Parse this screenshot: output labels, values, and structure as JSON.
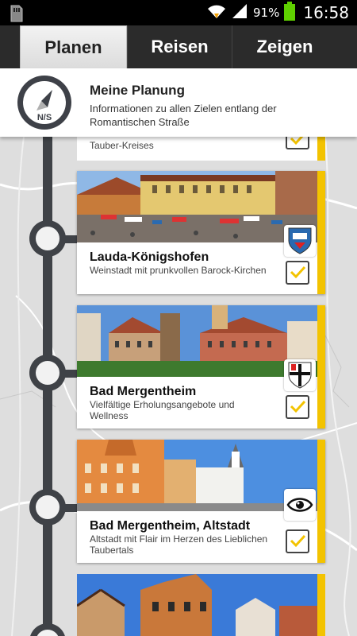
{
  "status_bar": {
    "battery_percent": "91%",
    "time": "16:58",
    "icons": [
      "sd-card-icon",
      "wifi-icon",
      "signal-icon",
      "battery-icon"
    ]
  },
  "tabs": [
    {
      "label": "Planen",
      "active": true
    },
    {
      "label": "Reisen",
      "active": false
    },
    {
      "label": "Zeigen",
      "active": false
    }
  ],
  "header": {
    "compass_label": "N/S",
    "title": "Meine Planung",
    "subtitle": "Informationen zu allen Zielen entlang der Romantischen Straße"
  },
  "cards": [
    {
      "title": "",
      "description": "Tauber-Kreises",
      "checked": true
    },
    {
      "title": "Lauda-Königshofen",
      "description": "Weinstadt mit prunkvollen Barock-Kirchen",
      "badge": "coat-of-arms-lauda",
      "checked": true
    },
    {
      "title": "Bad Mergentheim",
      "description": "Vielfältige Erholungsangebote und Wellness",
      "badge": "coat-of-arms-bad-mergentheim",
      "checked": true
    },
    {
      "title": "Bad Mergentheim, Altstadt",
      "description": "Altstadt mit Flair im Herzen des Lieblichen Taubertals",
      "badge": "eye-icon",
      "checked": true
    }
  ],
  "colors": {
    "accent_yellow": "#f3c300",
    "timeline": "#3f4247",
    "tab_bar": "#2b2b2b"
  }
}
